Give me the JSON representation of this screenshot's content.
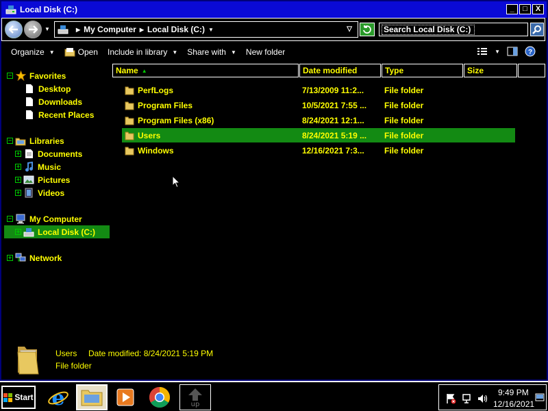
{
  "window": {
    "title": "Local Disk (C:)",
    "buttons": {
      "minimize": "_",
      "maximize": "□",
      "close": "X"
    }
  },
  "address": {
    "crumbs": [
      "My Computer",
      "Local Disk (C:)"
    ],
    "search_placeholder": "Search Local Disk (C:)"
  },
  "toolbar": {
    "organize": "Organize",
    "open": "Open",
    "include_in_library": "Include in library",
    "share_with": "Share with",
    "new_folder": "New folder"
  },
  "navpane": {
    "favorites": "Favorites",
    "favorites_items": [
      "Desktop",
      "Downloads",
      "Recent Places"
    ],
    "libraries": "Libraries",
    "libraries_items": [
      "Documents",
      "Music",
      "Pictures",
      "Videos"
    ],
    "my_computer": "My Computer",
    "local_disk": "Local Disk (C:)",
    "network": "Network"
  },
  "columns": {
    "name": "Name",
    "date_modified": "Date modified",
    "type": "Type",
    "size": "Size"
  },
  "files": [
    {
      "name": "PerfLogs",
      "date": "7/13/2009 11:2...",
      "type": "File folder",
      "selected": false
    },
    {
      "name": "Program Files",
      "date": "10/5/2021 7:55 ...",
      "type": "File folder",
      "selected": false
    },
    {
      "name": "Program Files (x86)",
      "date": "8/24/2021 12:1...",
      "type": "File folder",
      "selected": false
    },
    {
      "name": "Users",
      "date": "8/24/2021 5:19 ...",
      "type": "File folder",
      "selected": true
    },
    {
      "name": "Windows",
      "date": "12/16/2021 7:3...",
      "type": "File folder",
      "selected": false
    }
  ],
  "details": {
    "name": "Users",
    "date_label": "Date modified: 8/24/2021 5:19 PM",
    "type": "File folder"
  },
  "taskbar": {
    "start": "Start",
    "time": "9:49 PM",
    "date": "12/16/2021"
  },
  "colors": {
    "text": "#ffff00",
    "selection": "#138a13",
    "titlebar": "#0a0ad6"
  }
}
